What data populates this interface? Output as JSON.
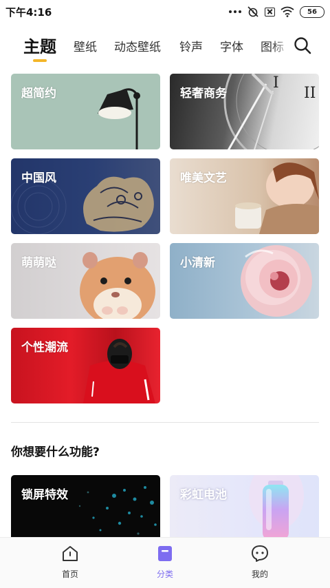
{
  "status_bar": {
    "time": "下午4:16",
    "battery": "56"
  },
  "tabs": [
    {
      "label": "主题",
      "active": true
    },
    {
      "label": "壁纸",
      "active": false
    },
    {
      "label": "动态壁纸",
      "active": false
    },
    {
      "label": "铃声",
      "active": false
    },
    {
      "label": "字体",
      "active": false
    },
    {
      "label": "图标",
      "active": false
    }
  ],
  "categories": [
    {
      "label": "超简约"
    },
    {
      "label": "轻奢商务"
    },
    {
      "label": "中国风"
    },
    {
      "label": "唯美文艺"
    },
    {
      "label": "萌萌哒"
    },
    {
      "label": "小清新"
    },
    {
      "label": "个性潮流"
    }
  ],
  "features_section": {
    "title": "你想要什么功能?",
    "items": [
      {
        "label": "锁屏特效"
      },
      {
        "label": "彩虹电池"
      }
    ]
  },
  "bottom_nav": [
    {
      "label": "首页",
      "icon": "home-icon",
      "active": false
    },
    {
      "label": "分类",
      "icon": "category-icon",
      "active": true
    },
    {
      "label": "我的",
      "icon": "profile-icon",
      "active": false
    }
  ],
  "colors": {
    "accent": "#7d6cf0",
    "tab_indicator": "#f3b62a"
  }
}
